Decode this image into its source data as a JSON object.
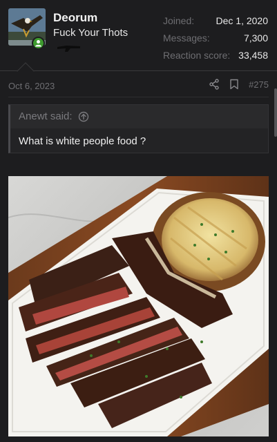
{
  "user": {
    "name": "Deorum",
    "title": "Fuck Your Thots",
    "stats": [
      {
        "label": "Joined:",
        "value": "Dec 1, 2020"
      },
      {
        "label": "Messages:",
        "value": "7,300"
      },
      {
        "label": "Reaction score:",
        "value": "33,458"
      }
    ]
  },
  "post": {
    "date": "Oct 6, 2023",
    "number": "#275",
    "icons": [
      "share-icon",
      "bookmark-icon"
    ]
  },
  "quote": {
    "author": "Anewt said:",
    "text": "What is white people food ?"
  },
  "colors": {
    "background": "#1d1d1f",
    "online": "#3e9b2f",
    "muted": "#6e6e72"
  }
}
